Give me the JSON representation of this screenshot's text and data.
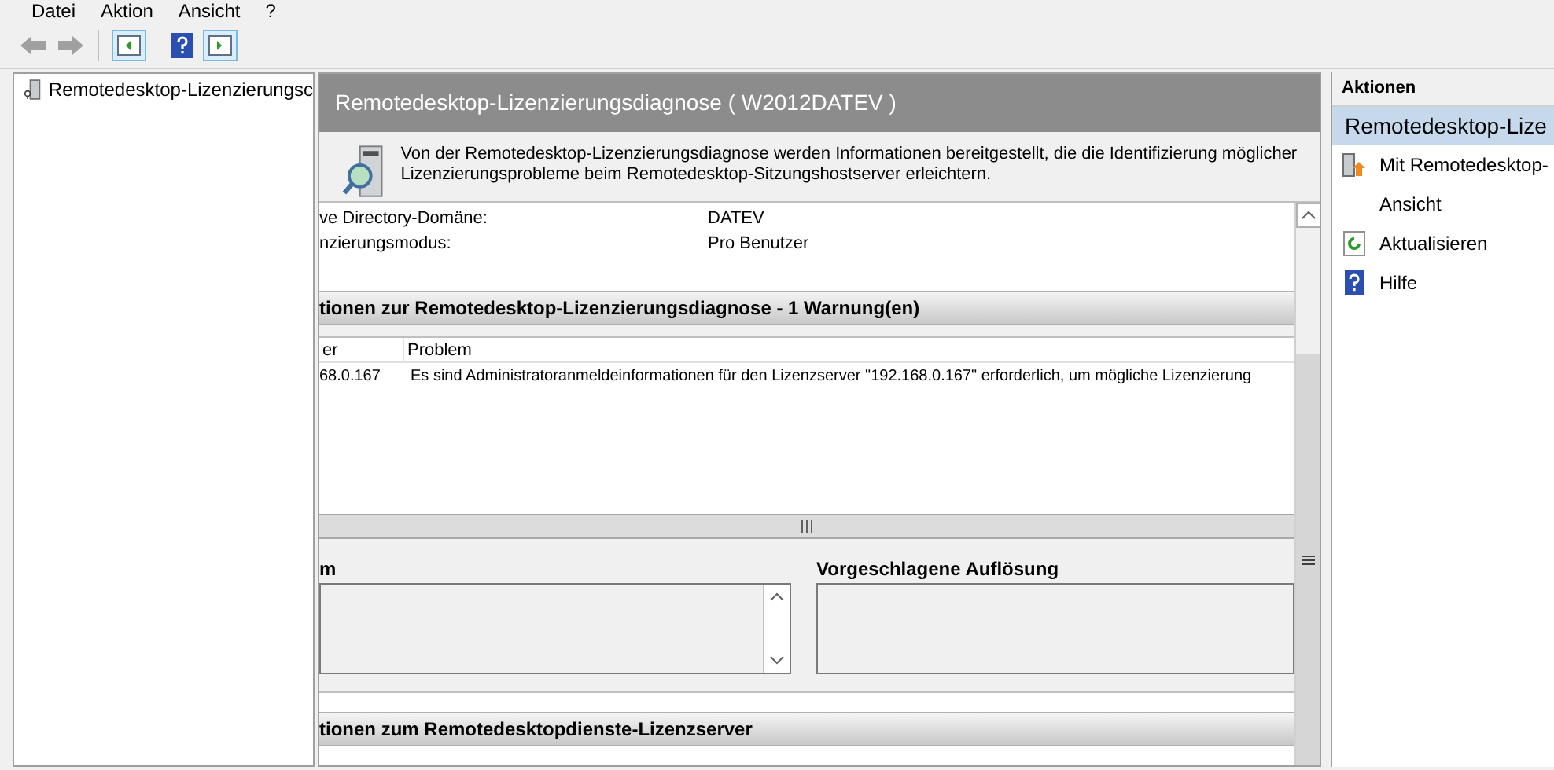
{
  "menu": [
    "Datei",
    "Aktion",
    "Ansicht",
    "?"
  ],
  "tree": {
    "items": [
      {
        "label": "Remotedesktop-Lizenzierungsc",
        "selected": false
      }
    ]
  },
  "panel": {
    "title": "Remotedesktop-Lizenzierungsdiagnose ( W2012DATEV )",
    "description": "Von der Remotedesktop-Lizenzierungsdiagnose werden Informationen bereitgestellt, die die Identifizierung möglicher Lizenzierungsprobleme beim Remotedesktop-Sitzungshostserver erleichtern.",
    "fields": [
      {
        "label": "ve Directory-Domäne:",
        "value": "DATEV"
      },
      {
        "label": "nzierungsmodus:",
        "value": "Pro Benutzer"
      }
    ],
    "section_1": "tionen zur Remotedesktop-Lizenzierungsdiagnose - 1 Warnung(en)",
    "table": {
      "columns": [
        "er",
        "Problem"
      ],
      "rows": [
        [
          "68.0.167",
          "Es sind Administratoranmeldeinformationen für den Lizenzserver \"192.168.0.167\" erforderlich, um mögliche Lizenzierung"
        ]
      ]
    },
    "detail_labels": [
      "m",
      "Vorgeschlagene Auflösung"
    ],
    "section_2": "tionen zum Remotedesktopdienste-Lizenzserver"
  },
  "actions": {
    "title": "Aktionen",
    "group": "Remotedesktop-Lize",
    "items": [
      {
        "kind": "connect",
        "label": "Mit Remotedesktop-"
      },
      {
        "kind": "plain",
        "label": "Ansicht"
      },
      {
        "kind": "refresh",
        "label": "Aktualisieren"
      },
      {
        "kind": "help",
        "label": "Hilfe"
      }
    ]
  }
}
